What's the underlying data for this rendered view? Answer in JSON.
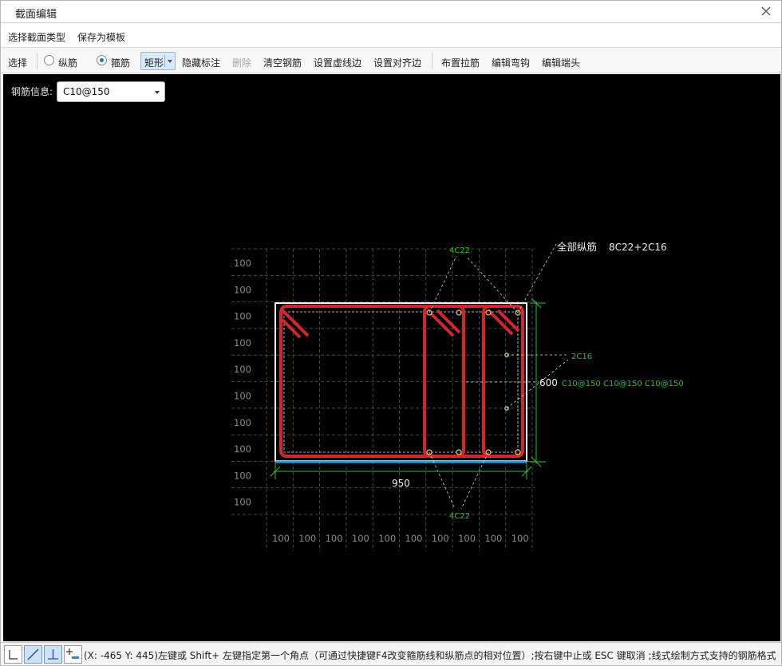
{
  "window": {
    "title": "截面编辑"
  },
  "menu": {
    "items": [
      "选择截面类型",
      "保存为模板"
    ]
  },
  "toolbar": {
    "select": "选择",
    "radio_long": "纵筋",
    "radio_stirrup": "箍筋",
    "shape": "矩形",
    "hide_labels": "隐藏标注",
    "delete": "删除",
    "clear_rebar": "清空钢筋",
    "set_dashed_edge": "设置虚线边",
    "set_align_edge": "设置对齐边",
    "place_tie": "布置拉筋",
    "edit_hook": "编辑弯钩",
    "edit_end": "编辑端头"
  },
  "rebar_info": {
    "label": "钢筋信息:",
    "value": "C10@150"
  },
  "drawing": {
    "grid_label": "100",
    "top_bars": "4C22",
    "bottom_bars": "4C22",
    "all_long_label": "全部纵筋",
    "all_long_value": "8C22+2C16",
    "side_bars": "2C16",
    "height": "600",
    "width": "950",
    "stirrups": "C10@150  C10@150  C10@150"
  },
  "status": {
    "text": "(X: -465 Y: 445)左键或 Shift+ 左键指定第一个角点（可通过快捷键F4改变箍筋线和纵筋点的相对位置）;按右键中止或 ESC 键取消 ;线式绘制方式支持的钢筋格式"
  },
  "colors": {
    "rebar": "#d0262c",
    "dim": "#26c226",
    "bottom_edge": "#2a9fe6",
    "grid": "#5a5a5a"
  }
}
